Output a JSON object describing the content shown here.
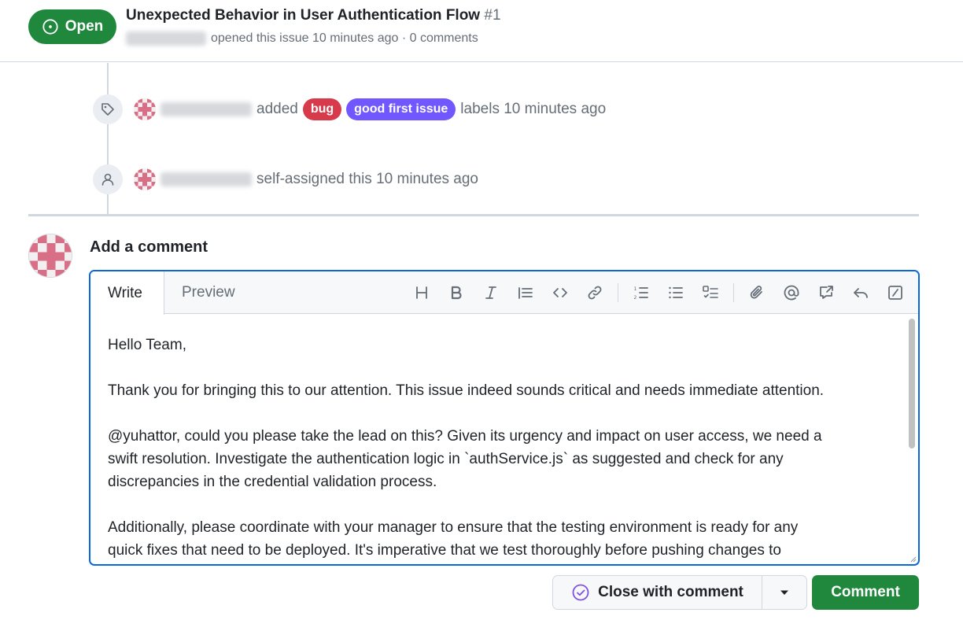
{
  "issue": {
    "state": "Open",
    "title": "Unexpected Behavior in User Authentication Flow",
    "number": "#1",
    "meta": "opened this issue 10 minutes ago · 0 comments"
  },
  "timeline": {
    "labeled": {
      "action": "added",
      "labels": [
        {
          "name": "bug",
          "color": "#d73a4a"
        },
        {
          "name": "good first issue",
          "color": "#7057ff"
        }
      ],
      "suffix": "labels 10 minutes ago"
    },
    "assigned": {
      "text": "self-assigned this 10 minutes ago"
    }
  },
  "composer": {
    "heading": "Add a comment",
    "tabs": {
      "write": "Write",
      "preview": "Preview"
    },
    "toolbar": [
      "heading-icon",
      "bold-icon",
      "italic-icon",
      "quote-icon",
      "code-icon",
      "link-icon",
      "ordered-list-icon",
      "unordered-list-icon",
      "task-list-icon",
      "attach-icon",
      "mention-icon",
      "cross-reference-icon",
      "reply-icon",
      "slash-command-icon"
    ],
    "body": [
      "Hello Team,",
      "Thank you for bringing this to our attention. This issue indeed sounds critical and needs immediate attention.",
      "@yuhattor, could you please take the lead on this? Given its urgency and impact on user access, we need a",
      "swift resolution. Investigate the authentication logic in `authService.js` as suggested and check for any",
      "discrepancies in the credential validation process.",
      "Additionally, please coordinate with your manager to ensure that the testing environment is ready for any",
      "quick fixes that need to be deployed. It's imperative that we test thoroughly before pushing changes to"
    ]
  },
  "actions": {
    "close_label": "Close with comment",
    "comment_label": "Comment"
  },
  "colors": {
    "open_green": "#1f883d",
    "accent_blue": "#0969da",
    "bug_red": "#d73a4a",
    "good_first_issue_purple": "#7057ff"
  }
}
